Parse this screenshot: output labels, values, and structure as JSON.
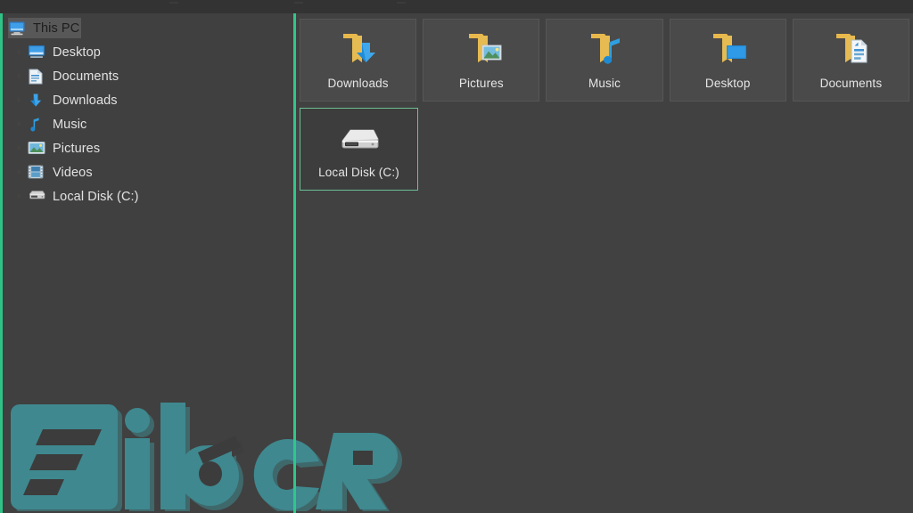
{
  "window": {
    "title": "This PC",
    "theme": "dark",
    "accent_color": "#2fc287",
    "panel_background": "#414141",
    "tile_background": "#4a4a4a",
    "selection_border_color": "#6dbf94"
  },
  "sidebar": {
    "root": {
      "label": "This PC",
      "icon": "this-pc-monitor-icon",
      "selected": true
    },
    "items": [
      {
        "label": "Desktop",
        "icon": "desktop-icon",
        "chevron": "›"
      },
      {
        "label": "Documents",
        "icon": "documents-icon",
        "chevron": "›"
      },
      {
        "label": "Downloads",
        "icon": "downloads-icon",
        "chevron": "›"
      },
      {
        "label": "Music",
        "icon": "music-note-icon",
        "chevron": "›"
      },
      {
        "label": "Pictures",
        "icon": "pictures-icon",
        "chevron": "›"
      },
      {
        "label": "Videos",
        "icon": "videos-icon",
        "chevron": "›"
      },
      {
        "label": "Local Disk (C:)",
        "icon": "hard-drive-icon",
        "chevron": "›"
      }
    ]
  },
  "content": {
    "rows": [
      [
        {
          "label": "Downloads",
          "icon": "folder-downloads-icon",
          "selected": false
        },
        {
          "label": "Pictures",
          "icon": "folder-pictures-icon",
          "selected": false
        },
        {
          "label": "Music",
          "icon": "folder-music-icon",
          "selected": false
        },
        {
          "label": "Desktop",
          "icon": "folder-desktop-icon",
          "selected": false
        },
        {
          "label": "Documents",
          "icon": "folder-documents-icon",
          "selected": false
        }
      ],
      [
        {
          "label": "Local Disk (C:)",
          "icon": "hard-drive-large-icon",
          "selected": true
        }
      ]
    ]
  },
  "watermark": {
    "text": "FileCR",
    "color": "#3f9ba3"
  }
}
